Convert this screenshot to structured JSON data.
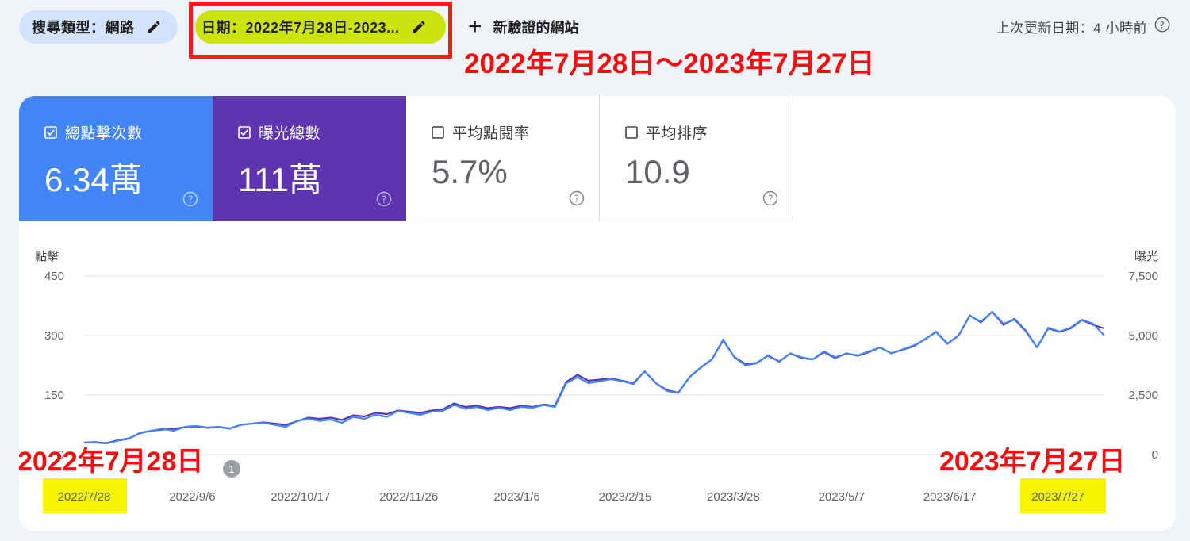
{
  "toolbar": {
    "search_type_label": "搜尋類型：網路",
    "date_label": "日期：2022年7月28日-2023...",
    "new_site_label": "新驗證的網站",
    "last_updated": "上次更新日期：4 小時前"
  },
  "annotations": {
    "range": "2022年7月28日～2023年7月27日",
    "start": "2022年7月28日",
    "end": "2023年7月27日"
  },
  "metrics": [
    {
      "label": "總點擊次數",
      "value": "6.34萬",
      "checked": true,
      "color": "#4285f4"
    },
    {
      "label": "曝光總數",
      "value": "111萬",
      "checked": true,
      "color": "#5e35b1"
    },
    {
      "label": "平均點閱率",
      "value": "5.7%",
      "checked": false
    },
    {
      "label": "平均排序",
      "value": "10.9",
      "checked": false
    }
  ],
  "colors": {
    "clicks": "#4285f4",
    "impressions": "#5e35b1",
    "annotation_red": "#f50f0f",
    "highlight_yellow": "#f5f500",
    "date_chip": "#cde30e"
  },
  "chart_data": {
    "type": "line",
    "left_axis_label": "點擊",
    "right_axis_label": "曝光",
    "left_ticks": [
      "0",
      "150",
      "300",
      "450"
    ],
    "right_ticks": [
      "0",
      "2,500",
      "5,000",
      "7,500"
    ],
    "ylim_left": [
      0,
      450
    ],
    "ylim_right": [
      0,
      7500
    ],
    "x_ticks": [
      "2022/7/28",
      "2022/9/6",
      "2022/10/17",
      "2022/11/26",
      "2023/1/6",
      "2023/2/15",
      "2023/3/28",
      "2023/5/7",
      "2023/6/17",
      "2023/7/27"
    ],
    "annotation_marker": "1",
    "grid": true,
    "series": [
      {
        "name": "總點擊次數",
        "axis": "left",
        "color": "#4285f4",
        "values": [
          30,
          30,
          28,
          35,
          40,
          55,
          60,
          65,
          60,
          70,
          72,
          68,
          70,
          65,
          75,
          78,
          80,
          75,
          70,
          85,
          90,
          85,
          88,
          80,
          95,
          90,
          100,
          95,
          110,
          105,
          100,
          108,
          110,
          125,
          115,
          120,
          112,
          118,
          112,
          120,
          118,
          125,
          120,
          180,
          195,
          180,
          185,
          190,
          185,
          178,
          210,
          180,
          160,
          155,
          195,
          220,
          240,
          290,
          245,
          225,
          230,
          250,
          235,
          255,
          245,
          240,
          260,
          245,
          255,
          250,
          260,
          270,
          255,
          265,
          275,
          290,
          310,
          280,
          300,
          350,
          335,
          360,
          330,
          340,
          310,
          270,
          320,
          310,
          320,
          340,
          330,
          300
        ]
      },
      {
        "name": "曝光總數",
        "axis": "right",
        "color": "#5e35b1",
        "values": [
          500,
          520,
          480,
          600,
          680,
          900,
          1000,
          1050,
          1080,
          1150,
          1180,
          1120,
          1150,
          1100,
          1250,
          1300,
          1350,
          1300,
          1250,
          1400,
          1550,
          1500,
          1550,
          1450,
          1650,
          1600,
          1750,
          1700,
          1850,
          1800,
          1750,
          1850,
          1900,
          2150,
          2000,
          2050,
          1950,
          2000,
          1950,
          2050,
          2000,
          2100,
          2050,
          3050,
          3350,
          3100,
          3150,
          3200,
          3100,
          3000,
          3500,
          3000,
          2700,
          2600,
          3250,
          3650,
          4000,
          4800,
          4100,
          3800,
          3850,
          4150,
          3900,
          4250,
          4050,
          4000,
          4300,
          4050,
          4250,
          4150,
          4300,
          4500,
          4250,
          4400,
          4550,
          4850,
          5150,
          4650,
          5000,
          5850,
          5550,
          6000,
          5450,
          5700,
          5200,
          4500,
          5300,
          5150,
          5300,
          5650,
          5450,
          5300
        ]
      }
    ]
  }
}
